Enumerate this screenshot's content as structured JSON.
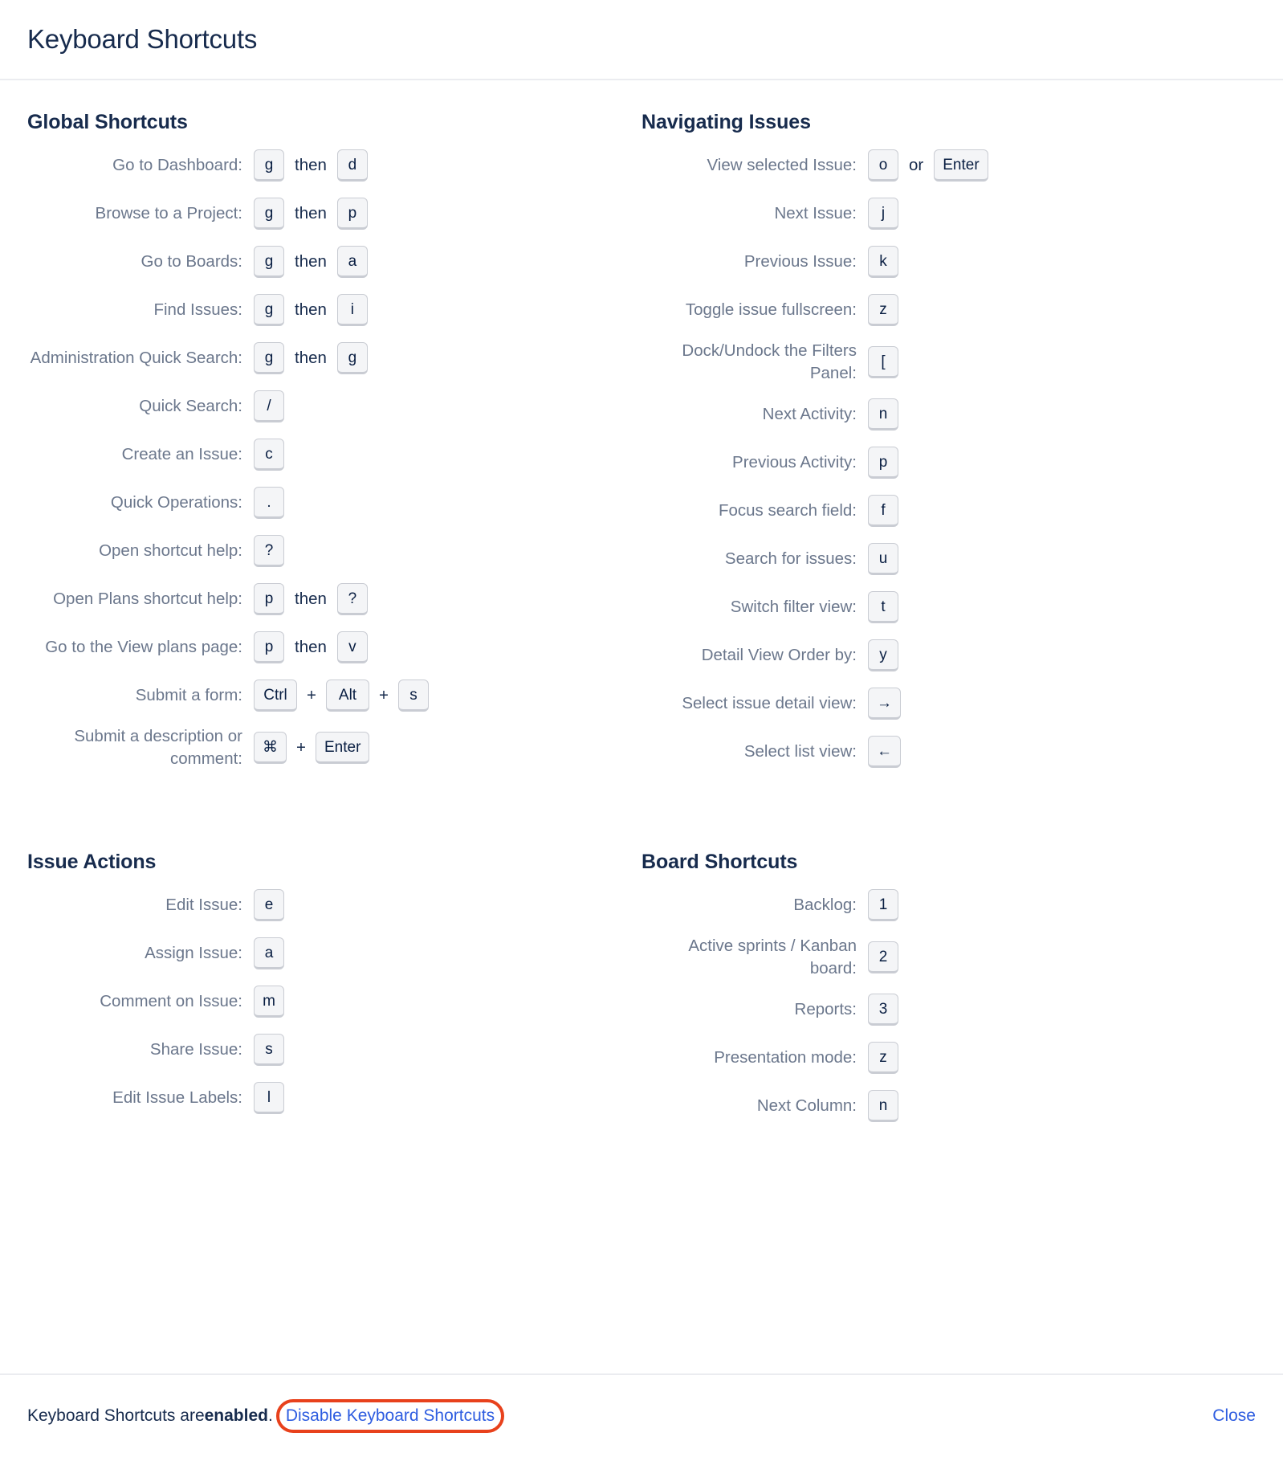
{
  "dialog": {
    "title": "Keyboard Shortcuts"
  },
  "sections": [
    {
      "id": "global-shortcuts",
      "title": "Global Shortcuts",
      "rows": [
        {
          "label": "Go to Dashboard:",
          "keys": [
            "g"
          ],
          "connector": "then",
          "keys2": [
            "d"
          ]
        },
        {
          "label": "Browse to a Project:",
          "keys": [
            "g"
          ],
          "connector": "then",
          "keys2": [
            "p"
          ]
        },
        {
          "label": "Go to Boards:",
          "keys": [
            "g"
          ],
          "connector": "then",
          "keys2": [
            "a"
          ]
        },
        {
          "label": "Find Issues:",
          "keys": [
            "g"
          ],
          "connector": "then",
          "keys2": [
            "i"
          ]
        },
        {
          "label": "Administration Quick Search:",
          "keys": [
            "g"
          ],
          "connector": "then",
          "keys2": [
            "g"
          ]
        },
        {
          "label": "Quick Search:",
          "keys": [
            "/"
          ]
        },
        {
          "label": "Create an Issue:",
          "keys": [
            "c"
          ]
        },
        {
          "label": "Quick Operations:",
          "keys": [
            "."
          ]
        },
        {
          "label": "Open shortcut help:",
          "keys": [
            "?"
          ]
        },
        {
          "label": "Open Plans shortcut help:",
          "keys": [
            "p"
          ],
          "connector": "then",
          "keys2": [
            "?"
          ]
        },
        {
          "label": "Go to the View plans page:",
          "keys": [
            "p"
          ],
          "connector": "then",
          "keys2": [
            "v"
          ]
        },
        {
          "label": "Submit a form:",
          "keys": [
            "Ctrl"
          ],
          "connector": "+",
          "keys2": [
            "Alt"
          ],
          "connector2": "+",
          "keys3": [
            "s"
          ]
        },
        {
          "label": "Submit a description or comment:",
          "keys": [
            "⌘"
          ],
          "connector": "+",
          "keys2": [
            "Enter"
          ]
        }
      ]
    },
    {
      "id": "navigating-issues",
      "title": "Navigating Issues",
      "rows": [
        {
          "label": "View selected Issue:",
          "keys": [
            "o"
          ],
          "connector": "or",
          "keys2": [
            "Enter"
          ]
        },
        {
          "label": "Next Issue:",
          "keys": [
            "j"
          ]
        },
        {
          "label": "Previous Issue:",
          "keys": [
            "k"
          ]
        },
        {
          "label": "Toggle issue fullscreen:",
          "keys": [
            "z"
          ]
        },
        {
          "label": "Dock/Undock the Filters Panel:",
          "keys": [
            "["
          ]
        },
        {
          "label": "Next Activity:",
          "keys": [
            "n"
          ]
        },
        {
          "label": "Previous Activity:",
          "keys": [
            "p"
          ]
        },
        {
          "label": "Focus search field:",
          "keys": [
            "f"
          ]
        },
        {
          "label": "Search for issues:",
          "keys": [
            "u"
          ]
        },
        {
          "label": "Switch filter view:",
          "keys": [
            "t"
          ]
        },
        {
          "label": "Detail View Order by:",
          "keys": [
            "y"
          ]
        },
        {
          "label": "Select issue detail view:",
          "keys": [
            "→"
          ]
        },
        {
          "label": "Select list view:",
          "keys": [
            "←"
          ]
        }
      ]
    },
    {
      "id": "issue-actions",
      "title": "Issue Actions",
      "rows": [
        {
          "label": "Edit Issue:",
          "keys": [
            "e"
          ]
        },
        {
          "label": "Assign Issue:",
          "keys": [
            "a"
          ]
        },
        {
          "label": "Comment on Issue:",
          "keys": [
            "m"
          ]
        },
        {
          "label": "Share Issue:",
          "keys": [
            "s"
          ]
        },
        {
          "label": "Edit Issue Labels:",
          "keys": [
            "l"
          ]
        }
      ]
    },
    {
      "id": "board-shortcuts",
      "title": "Board Shortcuts",
      "rows": [
        {
          "label": "Backlog:",
          "keys": [
            "1"
          ]
        },
        {
          "label": "Active sprints / Kanban board:",
          "keys": [
            "2"
          ]
        },
        {
          "label": "Reports:",
          "keys": [
            "3"
          ]
        },
        {
          "label": "Presentation mode:",
          "keys": [
            "z"
          ]
        },
        {
          "label": "Next Column:",
          "keys": [
            "n"
          ]
        }
      ]
    }
  ],
  "footer": {
    "status_prefix": "Keyboard Shortcuts are ",
    "status_state": "enabled",
    "status_suffix": ".",
    "disable_link": "Disable Keyboard Shortcuts",
    "close_label": "Close",
    "annotation_color": "#e8411c"
  }
}
